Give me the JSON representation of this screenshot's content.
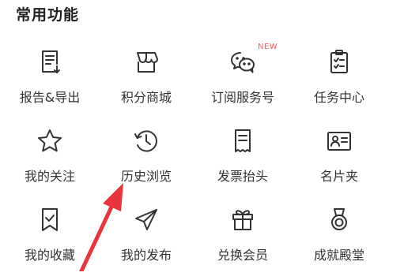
{
  "section": {
    "title": "常用功能"
  },
  "badge": "NEW",
  "accent": "#e8343a",
  "items": [
    {
      "label": "报告&导出",
      "icon": "report-export-icon"
    },
    {
      "label": "积分商城",
      "icon": "store-icon"
    },
    {
      "label": "订阅服务号",
      "icon": "wechat-icon"
    },
    {
      "label": "任务中心",
      "icon": "task-clipboard-icon"
    },
    {
      "label": "我的关注",
      "icon": "star-icon"
    },
    {
      "label": "历史浏览",
      "icon": "history-icon"
    },
    {
      "label": "发票抬头",
      "icon": "receipt-icon"
    },
    {
      "label": "名片夹",
      "icon": "business-card-icon"
    },
    {
      "label": "我的收藏",
      "icon": "bookmark-check-icon"
    },
    {
      "label": "我的发布",
      "icon": "paper-plane-icon"
    },
    {
      "label": "兑换会员",
      "icon": "gift-icon"
    },
    {
      "label": "成就殿堂",
      "icon": "medal-icon"
    }
  ]
}
